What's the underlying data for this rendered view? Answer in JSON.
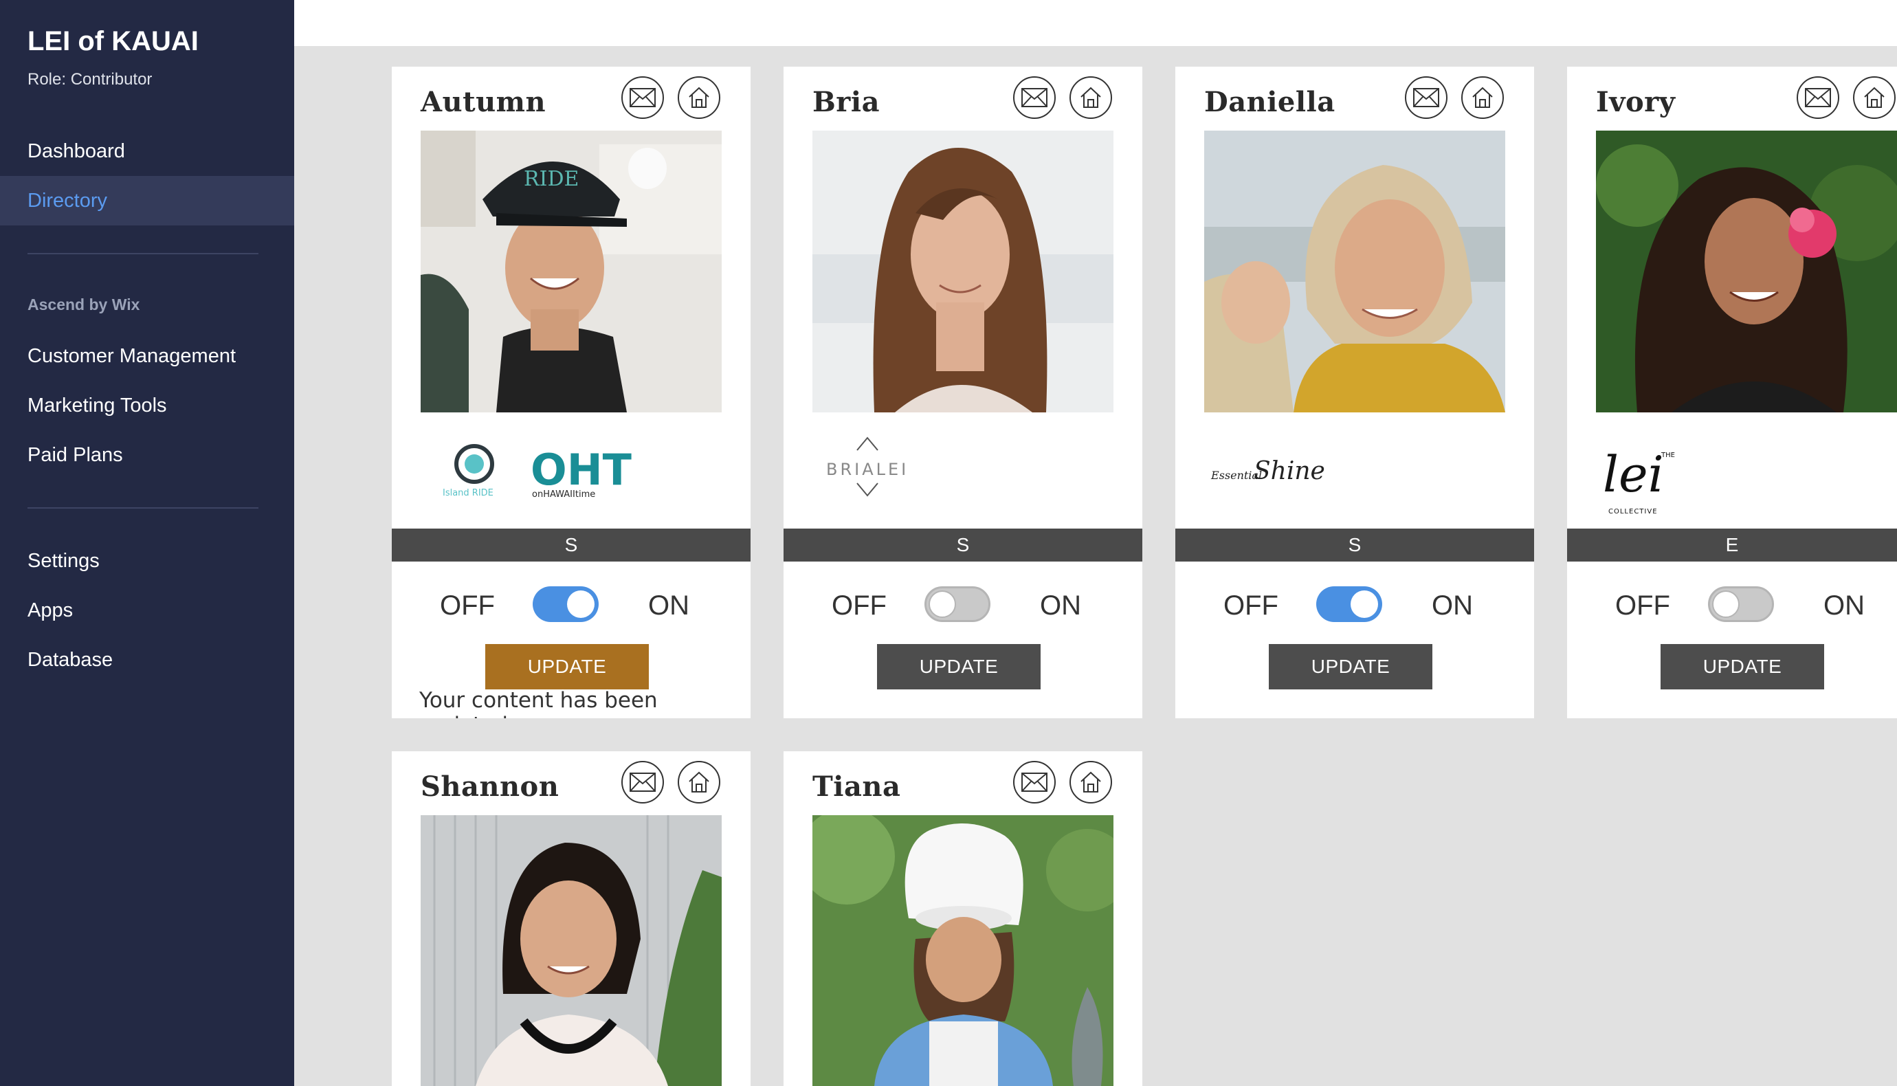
{
  "app": {
    "title": "LEI of KAUAI",
    "role": "Role: Contributor"
  },
  "sidebar": {
    "primary": [
      {
        "label": "Dashboard",
        "active": false
      },
      {
        "label": "Directory",
        "active": true
      }
    ],
    "section_title": "Ascend by Wix",
    "section_items": [
      {
        "label": "Customer Management"
      },
      {
        "label": "Marketing Tools"
      },
      {
        "label": "Paid Plans"
      }
    ],
    "bottom_items": [
      {
        "label": "Settings"
      },
      {
        "label": "Apps"
      },
      {
        "label": "Database"
      }
    ]
  },
  "toggle_labels": {
    "off": "OFF",
    "on": "ON"
  },
  "button_label": "UPDATE",
  "cards": [
    {
      "name": "Autumn",
      "letter": "S",
      "toggle": "on",
      "highlight_button": true,
      "notice": "Your content has been updated",
      "logos": [
        "Island RIDE",
        "onHAWAIItime"
      ]
    },
    {
      "name": "Bria",
      "letter": "S",
      "toggle": "off",
      "logos": [
        "BRIALEI"
      ]
    },
    {
      "name": "Daniella",
      "letter": "S",
      "toggle": "on",
      "logos": [
        "EssentialShine"
      ]
    },
    {
      "name": "Ivory",
      "letter": "E",
      "toggle": "off",
      "logos": [
        "THE lei COLLECTIVE"
      ]
    },
    {
      "name": "Shannon"
    },
    {
      "name": "Tiana"
    }
  ],
  "colors": {
    "sidebar_bg": "#232944",
    "active_nav_text": "#5b9bf0",
    "toggle_on": "#4a90e2",
    "update_highlight": "#a97020",
    "update_default": "#4d4d4d"
  },
  "icons": [
    "mail-icon",
    "home-icon"
  ]
}
